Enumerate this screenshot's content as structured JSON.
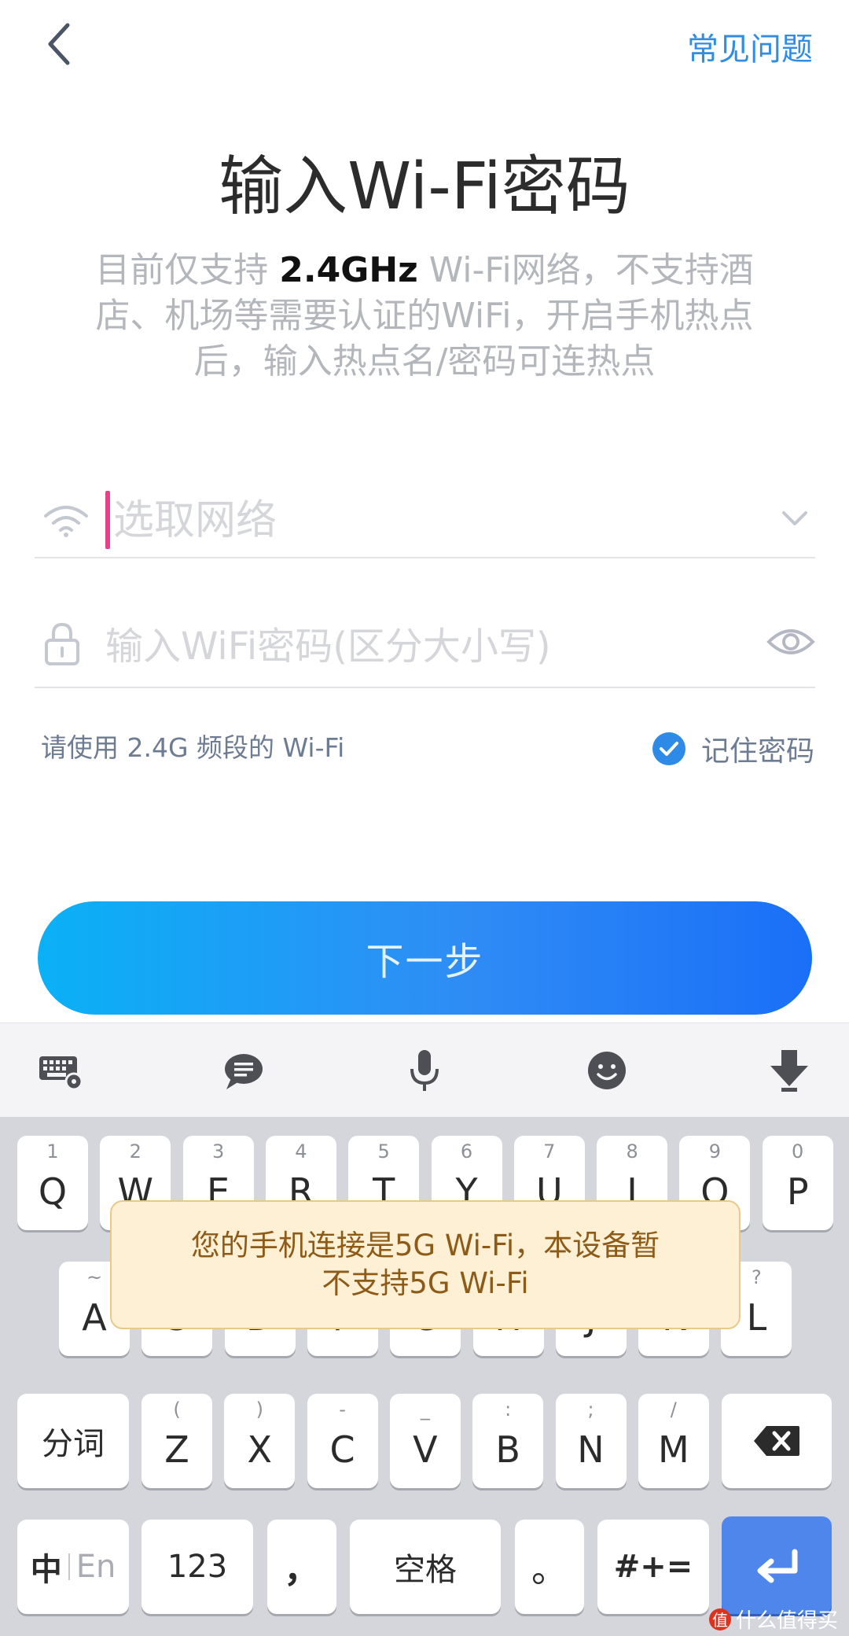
{
  "header": {
    "faq_label": "常见问题"
  },
  "page": {
    "title": "输入Wi-Fi密码",
    "desc_part1": "目前仅支持 ",
    "desc_bold": "2.4GHz",
    "desc_part2": " Wi-Fi网络，不支持酒店、机场等需要认证的WiFi，开启手机热点后，输入热点名/密码可连热点"
  },
  "form": {
    "ssid_placeholder": "选取网络",
    "password_placeholder": "输入WiFi密码(区分大小写)",
    "hint": "请使用 2.4G 频段的 Wi-Fi",
    "remember_label": "记住密码",
    "remember_checked": true,
    "next_label": "下一步"
  },
  "toast": {
    "line1": "您的手机连接是5G Wi-Fi，本设备暂",
    "line2": "不支持5G Wi-Fi"
  },
  "keyboard": {
    "row1": [
      {
        "main": "Q",
        "sub": "1"
      },
      {
        "main": "W",
        "sub": "2"
      },
      {
        "main": "E",
        "sub": "3"
      },
      {
        "main": "R",
        "sub": "4"
      },
      {
        "main": "T",
        "sub": "5"
      },
      {
        "main": "Y",
        "sub": "6"
      },
      {
        "main": "U",
        "sub": "7"
      },
      {
        "main": "I",
        "sub": "8"
      },
      {
        "main": "O",
        "sub": "9"
      },
      {
        "main": "P",
        "sub": "0"
      }
    ],
    "row2": [
      {
        "main": "A",
        "sub": "~"
      },
      {
        "main": "S",
        "sub": ""
      },
      {
        "main": "D",
        "sub": ""
      },
      {
        "main": "F",
        "sub": ""
      },
      {
        "main": "G",
        "sub": ""
      },
      {
        "main": "H",
        "sub": ""
      },
      {
        "main": "J",
        "sub": ""
      },
      {
        "main": "K",
        "sub": ""
      },
      {
        "main": "L",
        "sub": "?"
      }
    ],
    "row3": [
      {
        "main": "Z",
        "sub": "("
      },
      {
        "main": "X",
        "sub": ")"
      },
      {
        "main": "C",
        "sub": "-"
      },
      {
        "main": "V",
        "sub": "_"
      },
      {
        "main": "B",
        "sub": ":"
      },
      {
        "main": "N",
        "sub": ";"
      },
      {
        "main": "M",
        "sub": "/"
      }
    ],
    "fenci_label": "分词",
    "lang_zh": "中",
    "lang_en": "En",
    "num_label": "123",
    "comma_label": "，",
    "space_label": "空格",
    "period_label": "。",
    "symbol_label": "#+="
  },
  "watermark": {
    "badge": "值",
    "text": "什么值得买"
  },
  "colors": {
    "accent": "#2f8de4",
    "cursor": "#ec3f89",
    "toast_bg": "#fdf0d4",
    "toast_text": "#8e5a17",
    "enter_key": "#4f86eb"
  }
}
